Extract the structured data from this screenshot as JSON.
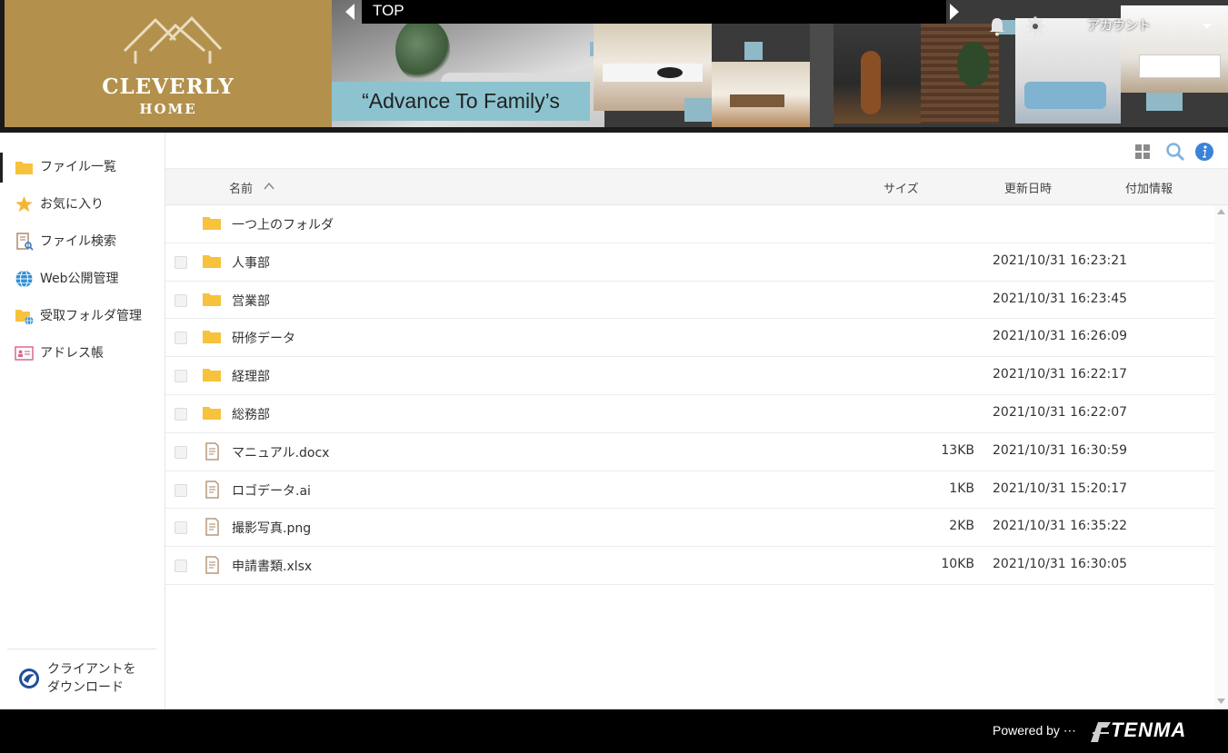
{
  "header": {
    "brand_line1": "CLEVERLY",
    "brand_line2": "HOME",
    "tagline": "“Advance To Family’s Smile”",
    "page_title": "TOP",
    "account_label": "アカウント"
  },
  "sidebar": {
    "items": [
      {
        "label": "ファイル一覧",
        "icon": "folder-icon",
        "active": true
      },
      {
        "label": "お気に入り",
        "icon": "star-icon"
      },
      {
        "label": "ファイル検索",
        "icon": "file-search-icon"
      },
      {
        "label": "Web公開管理",
        "icon": "globe-icon"
      },
      {
        "label": "受取フォルダ管理",
        "icon": "inbox-folder-icon"
      },
      {
        "label": "アドレス帳",
        "icon": "address-book-icon"
      }
    ],
    "client_download": {
      "line1": "クライアントを",
      "line2": "ダウンロード"
    }
  },
  "columns": {
    "name": "名前",
    "size": "サイズ",
    "date": "更新日時",
    "extra": "付加情報"
  },
  "files": {
    "parent": {
      "name": "一つ上のフォルダ"
    },
    "rows": [
      {
        "name": "人事部",
        "type": "folder",
        "size": "",
        "date": "2021/10/31 16:23:21"
      },
      {
        "name": "営業部",
        "type": "folder",
        "size": "",
        "date": "2021/10/31 16:23:45"
      },
      {
        "name": "研修データ",
        "type": "folder",
        "size": "",
        "date": "2021/10/31 16:26:09"
      },
      {
        "name": "経理部",
        "type": "folder",
        "size": "",
        "date": "2021/10/31 16:22:17"
      },
      {
        "name": "総務部",
        "type": "folder",
        "size": "",
        "date": "2021/10/31 16:22:07"
      },
      {
        "name": "マニュアル.docx",
        "type": "file",
        "size": "13KB",
        "date": "2021/10/31 16:30:59"
      },
      {
        "name": "ロゴデータ.ai",
        "type": "file",
        "size": "1KB",
        "date": "2021/10/31 15:20:17"
      },
      {
        "name": "撮影写真.png",
        "type": "file",
        "size": "2KB",
        "date": "2021/10/31 16:35:22"
      },
      {
        "name": "申請書類.xlsx",
        "type": "file",
        "size": "10KB",
        "date": "2021/10/31 16:30:05"
      }
    ]
  },
  "footer": {
    "powered_by": "Powered by ⋯",
    "vendor": "TENMA"
  },
  "colors": {
    "brand_gold": "#b3914c",
    "tagline_bg": "#8cc3cf",
    "folder": "#f7c23c",
    "info_blue": "#3a83d6"
  }
}
